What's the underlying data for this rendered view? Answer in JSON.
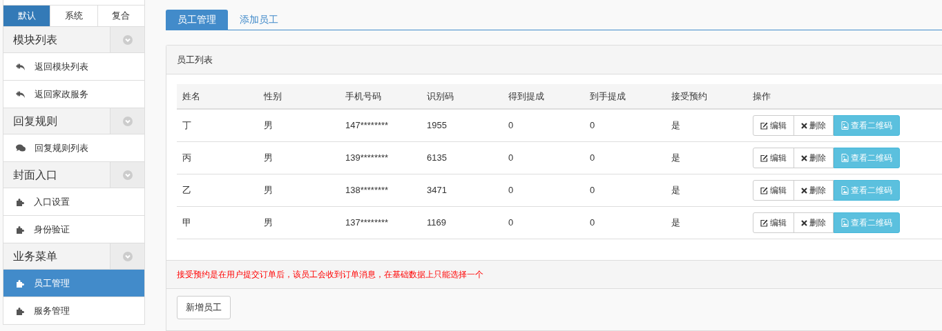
{
  "sidebar": {
    "tabs": [
      {
        "label": "默认",
        "selected": true
      },
      {
        "label": "系统",
        "selected": false
      },
      {
        "label": "复合",
        "selected": false
      }
    ],
    "sections": [
      {
        "title": "模块列表",
        "items": [
          {
            "label": "返回模块列表",
            "kind": "reply",
            "selected": false
          },
          {
            "label": "返回家政服务",
            "kind": "reply",
            "selected": false
          }
        ]
      },
      {
        "title": "回复规则",
        "items": [
          {
            "label": "回复规则列表",
            "kind": "comments",
            "selected": false
          }
        ]
      },
      {
        "title": "封面入口",
        "items": [
          {
            "label": "入口设置",
            "kind": "puzzle",
            "selected": false
          },
          {
            "label": "身份验证",
            "kind": "puzzle",
            "selected": false
          }
        ]
      },
      {
        "title": "业务菜单",
        "items": [
          {
            "label": "员工管理",
            "kind": "puzzle",
            "selected": true
          },
          {
            "label": "服务管理",
            "kind": "puzzle",
            "selected": false
          }
        ]
      }
    ]
  },
  "tabs": [
    {
      "label": "员工管理",
      "selected": true
    },
    {
      "label": "添加员工",
      "selected": false
    }
  ],
  "panel": {
    "title": "员工列表",
    "table": {
      "columns": [
        "姓名",
        "性别",
        "手机号码",
        "识别码",
        "得到提成",
        "到手提成",
        "接受预约",
        "操作"
      ],
      "rows": [
        {
          "cells": [
            "丁",
            "男",
            "147********",
            "1955",
            "0",
            "0",
            "是"
          ],
          "actions": [
            {
              "label": "编辑",
              "kind": "edit"
            },
            {
              "label": "删除",
              "kind": "remove"
            },
            {
              "label": "查看二维码",
              "kind": "qrcode"
            }
          ]
        },
        {
          "cells": [
            "丙",
            "男",
            "139********",
            "6135",
            "0",
            "0",
            "是"
          ],
          "actions": [
            {
              "label": "编辑",
              "kind": "edit"
            },
            {
              "label": "删除",
              "kind": "remove"
            },
            {
              "label": "查看二维码",
              "kind": "qrcode"
            }
          ]
        },
        {
          "cells": [
            "乙",
            "男",
            "138********",
            "3471",
            "0",
            "0",
            "是"
          ],
          "actions": [
            {
              "label": "编辑",
              "kind": "edit"
            },
            {
              "label": "删除",
              "kind": "remove"
            },
            {
              "label": "查看二维码",
              "kind": "qrcode"
            }
          ]
        },
        {
          "cells": [
            "甲",
            "男",
            "137********",
            "1169",
            "0",
            "0",
            "是"
          ],
          "actions": [
            {
              "label": "编辑",
              "kind": "edit"
            },
            {
              "label": "删除",
              "kind": "remove"
            },
            {
              "label": "查看二维码",
              "kind": "qrcode"
            }
          ]
        }
      ]
    },
    "note": "接受预约是在用户提交订单后，该员工会收到订单消息，在基础数据上只能选择一个",
    "footer_button": "新增员工"
  }
}
